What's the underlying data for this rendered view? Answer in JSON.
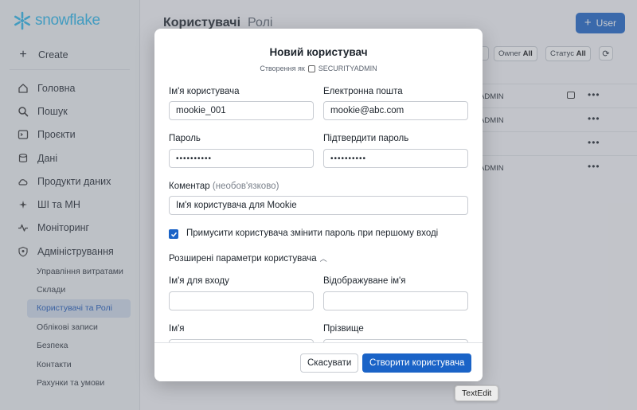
{
  "app": {
    "logo_text": "snowflake",
    "brand_color": "#29b5e8",
    "accent_color": "#1a63c7"
  },
  "sidebar": {
    "create_label": "Create",
    "items": [
      {
        "label": "Головна",
        "icon": "home-icon"
      },
      {
        "label": "Пошук",
        "icon": "search-icon"
      },
      {
        "label": "Проєкти",
        "icon": "terminal-icon"
      },
      {
        "label": "Дані",
        "icon": "database-icon"
      },
      {
        "label": "Продукти даних",
        "icon": "cloud-icon"
      },
      {
        "label": "ШІ та МН",
        "icon": "sparkle-icon"
      },
      {
        "label": "Моніторинг",
        "icon": "activity-icon"
      },
      {
        "label": "Адміністрування",
        "icon": "shield-icon"
      }
    ],
    "sub_items": [
      {
        "label": "Управління витратами"
      },
      {
        "label": "Склади"
      },
      {
        "label": "Користувачі та Ролі",
        "active": true
      },
      {
        "label": "Облікові записи"
      },
      {
        "label": "Безпека"
      },
      {
        "label": "Контакти"
      },
      {
        "label": "Рахунки та умови"
      }
    ]
  },
  "main": {
    "title": "Користувачі",
    "title_secondary": "Ролі",
    "user_button": "User",
    "filters": [
      {
        "name": "Owner",
        "value": "All"
      },
      {
        "name": "Статус",
        "value": "All"
      }
    ],
    "rows": [
      {
        "cell": "ADMIN",
        "has_comment": true
      },
      {
        "cell": "ADMIN",
        "has_comment": false
      },
      {
        "cell": "",
        "has_comment": false
      },
      {
        "cell": "ADMIN",
        "has_comment": false
      }
    ],
    "more_label": "•••"
  },
  "modal": {
    "title": "Новий користувач",
    "subtitle_prefix": "Створення як",
    "subtitle_role": "SECURITYADMIN",
    "username_label": "Ім'я користувача",
    "username_value": "mookie_001",
    "email_label": "Електронна пошта",
    "email_value": "mookie@abc.com",
    "password_label": "Пароль",
    "password_value": "••••••••••",
    "confirm_label": "Підтвердити пароль",
    "confirm_value": "••••••••••",
    "comment_label": "Коментар",
    "comment_optional": "(необов'язково)",
    "comment_value": "Ім'я користувача для Mookie",
    "force_change_label": "Примусити користувача змінити пароль при першому вході",
    "force_change_checked": true,
    "advanced_label": "Розширені параметри користувача",
    "login_name_label": "Ім'я для входу",
    "display_name_label": "Відображуване ім'я",
    "first_name_label": "Ім'я",
    "last_name_label": "Прізвище",
    "cancel_button": "Скасувати",
    "create_button": "Створити користувача"
  },
  "tooltip": "TextEdit"
}
